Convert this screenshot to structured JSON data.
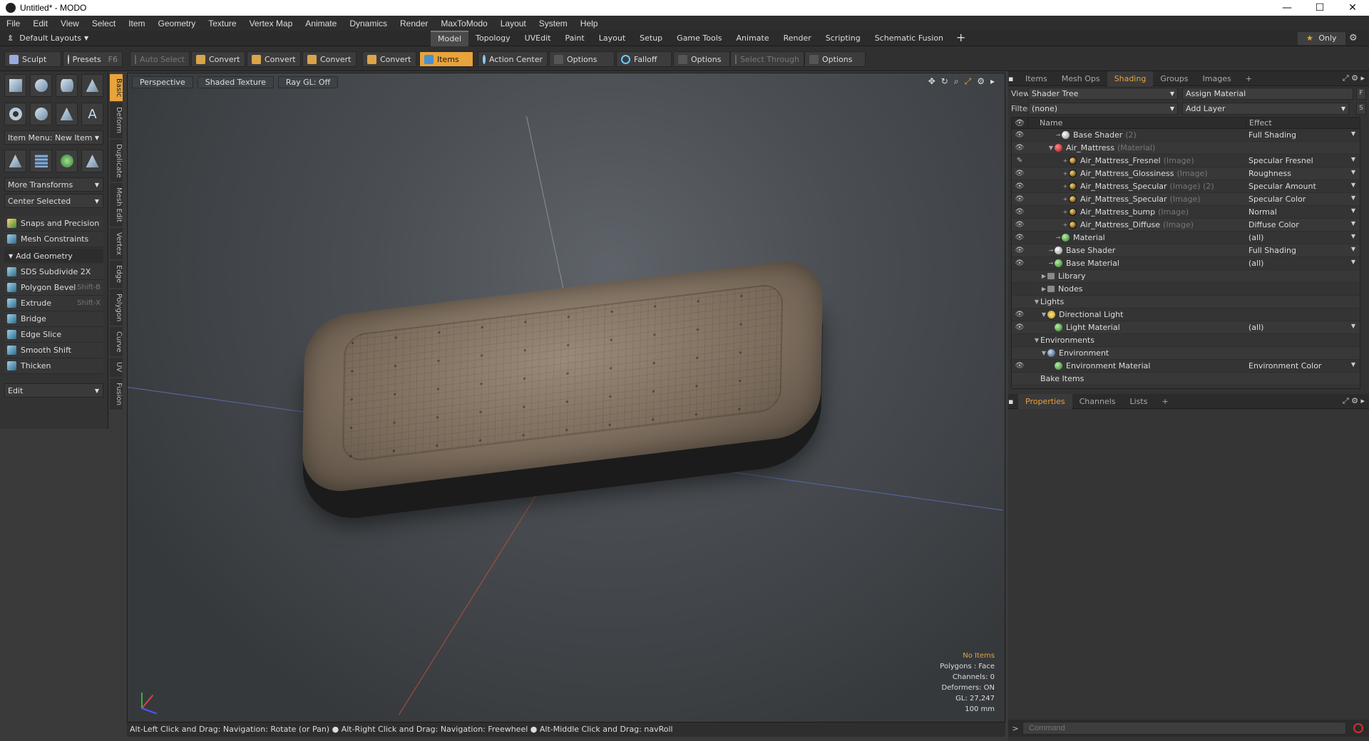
{
  "window": {
    "title": "Untitled* - MODO",
    "controls": [
      "—",
      "☐",
      "✕"
    ]
  },
  "menu": [
    "File",
    "Edit",
    "View",
    "Select",
    "Item",
    "Geometry",
    "Texture",
    "Vertex Map",
    "Animate",
    "Dynamics",
    "Render",
    "MaxToModo",
    "Layout",
    "System",
    "Help"
  ],
  "layoutbar": {
    "layout_select": "Default Layouts",
    "tabs": [
      "Model",
      "Topology",
      "UVEdit",
      "Paint",
      "Layout",
      "Setup",
      "Game Tools",
      "Animate",
      "Render",
      "Scripting",
      "Schematic Fusion"
    ],
    "active_tab": "Model",
    "plus": "+",
    "only": "Only"
  },
  "toolbar": {
    "sculpt": "Sculpt",
    "presets": "Presets",
    "presets_shortcut": "F6",
    "auto_select": "Auto Select",
    "convert1": "Convert",
    "convert2": "Convert",
    "convert3": "Convert",
    "convert4": "Convert",
    "items": "Items",
    "action_center": "Action Center",
    "options1": "Options",
    "falloff": "Falloff",
    "options2": "Options",
    "select_through": "Select Through",
    "options3": "Options"
  },
  "leftpanel": {
    "item_menu": "Item Menu: New Item",
    "more_transforms": "More Transforms",
    "center_selected": "Center Selected",
    "snaps": "Snaps and Precision",
    "mesh_constraints": "Mesh Constraints",
    "add_geometry": "Add Geometry",
    "tools": [
      {
        "label": "SDS Subdivide 2X",
        "shortcut": ""
      },
      {
        "label": "Polygon Bevel",
        "shortcut": "Shift-B"
      },
      {
        "label": "Extrude",
        "shortcut": "Shift-X"
      },
      {
        "label": "Bridge",
        "shortcut": ""
      },
      {
        "label": "Edge Slice",
        "shortcut": ""
      },
      {
        "label": "Smooth Shift",
        "shortcut": ""
      },
      {
        "label": "Thicken",
        "shortcut": ""
      }
    ],
    "edit_select": "Edit"
  },
  "vtabs": [
    "Basic",
    "Deform",
    "Duplicate",
    "Mesh Edit",
    "Vertex",
    "Edge",
    "Polygon",
    "Curve",
    "UV",
    "Fusion"
  ],
  "viewport": {
    "view": "Perspective",
    "shading": "Shaded Texture",
    "raygl": "Ray GL: Off",
    "info": {
      "no_items": "No Items",
      "polygons": "Polygons : Face",
      "channels": "Channels: 0",
      "deformers": "Deformers: ON",
      "gl": "GL: 27,247",
      "scale": "100 mm"
    }
  },
  "statusbar": "Alt-Left Click and Drag: Navigation: Rotate (or Pan) ● Alt-Right Click and Drag: Navigation: Freewheel ● Alt-Middle Click and Drag: navRoll",
  "rightpanel": {
    "tabs": [
      "Items",
      "Mesh Ops",
      "Shading",
      "Groups",
      "Images",
      "+"
    ],
    "active_tab": "Shading",
    "view_label": "View",
    "view_value": "Shader Tree",
    "assign_material": "Assign Material",
    "f_button": "F",
    "filter_label": "Filter",
    "filter_value": "(none)",
    "add_layer": "Add Layer",
    "s_button": "S",
    "columns": {
      "name": "Name",
      "effect": "Effect"
    },
    "rows": [
      {
        "eye": "👁",
        "name": "Base Shader",
        "type": "(2)",
        "effect": "Full Shading",
        "ball": "white",
        "indent": 3,
        "twist": "→"
      },
      {
        "eye": "👁",
        "name": "Air_Mattress",
        "type": "(Material)",
        "effect": "",
        "ball": "red",
        "indent": 2,
        "twist": "▼"
      },
      {
        "eye": "✎",
        "name": "Air_Mattress_Fresnel",
        "type": "(Image)",
        "effect": "Specular Fresnel",
        "ball": "img",
        "indent": 4,
        "twist": "+"
      },
      {
        "eye": "👁",
        "name": "Air_Mattress_Glossiness",
        "type": "(Image)",
        "effect": "Roughness",
        "ball": "img",
        "indent": 4,
        "twist": "+"
      },
      {
        "eye": "👁",
        "name": "Air_Mattress_Specular",
        "type": "(Image) (2)",
        "effect": "Specular Amount",
        "ball": "img",
        "indent": 4,
        "twist": "+"
      },
      {
        "eye": "👁",
        "name": "Air_Mattress_Specular",
        "type": "(Image)",
        "effect": "Specular Color",
        "ball": "img",
        "indent": 4,
        "twist": "+"
      },
      {
        "eye": "👁",
        "name": "Air_Mattress_bump",
        "type": "(Image)",
        "effect": "Normal",
        "ball": "img",
        "indent": 4,
        "twist": "+"
      },
      {
        "eye": "👁",
        "name": "Air_Mattress_Diffuse",
        "type": "(Image)",
        "effect": "Diffuse Color",
        "ball": "img",
        "indent": 4,
        "twist": "+"
      },
      {
        "eye": "👁",
        "name": "Material",
        "type": "",
        "effect": "(all)",
        "ball": "green",
        "indent": 3,
        "twist": "→"
      },
      {
        "eye": "👁",
        "name": "Base Shader",
        "type": "",
        "effect": "Full Shading",
        "ball": "white",
        "indent": 2,
        "twist": "→"
      },
      {
        "eye": "👁",
        "name": "Base Material",
        "type": "",
        "effect": "(all)",
        "ball": "green",
        "indent": 2,
        "twist": "→"
      },
      {
        "eye": "",
        "name": "Library",
        "type": "",
        "effect": "",
        "ball": "folder",
        "indent": 1,
        "twist": "▶"
      },
      {
        "eye": "",
        "name": "Nodes",
        "type": "",
        "effect": "",
        "ball": "folder",
        "indent": 1,
        "twist": "▶"
      },
      {
        "eye": "",
        "name": "Lights",
        "type": "",
        "effect": "",
        "ball": "",
        "indent": 0,
        "twist": "▼"
      },
      {
        "eye": "👁",
        "name": "Directional Light",
        "type": "",
        "effect": "",
        "ball": "light",
        "indent": 1,
        "twist": "▼"
      },
      {
        "eye": "👁",
        "name": "Light Material",
        "type": "",
        "effect": "(all)",
        "ball": "green",
        "indent": 2,
        "twist": ""
      },
      {
        "eye": "",
        "name": "Environments",
        "type": "",
        "effect": "",
        "ball": "",
        "indent": 0,
        "twist": "▼"
      },
      {
        "eye": "",
        "name": "Environment",
        "type": "",
        "effect": "",
        "ball": "blue",
        "indent": 1,
        "twist": "▼"
      },
      {
        "eye": "👁",
        "name": "Environment Material",
        "type": "",
        "effect": "Environment Color",
        "ball": "green",
        "indent": 2,
        "twist": ""
      },
      {
        "eye": "",
        "name": "Bake Items",
        "type": "",
        "effect": "",
        "ball": "",
        "indent": 0,
        "twist": ""
      }
    ],
    "prop_tabs": [
      "Properties",
      "Channels",
      "Lists",
      "+"
    ],
    "prop_active": "Properties",
    "command_prompt": ">",
    "command_placeholder": "Command"
  },
  "colors": {
    "accent": "#e8a33c",
    "panel": "#333333",
    "viewport": "#4a4e53"
  }
}
